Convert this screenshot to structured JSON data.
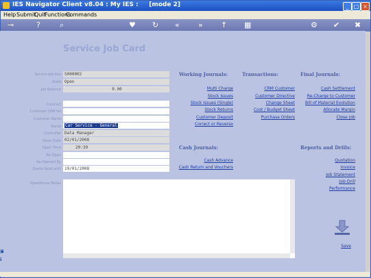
{
  "window": {
    "title": "IES Navigator Client v8.04 : My IES :     [mode 2]"
  },
  "menu": [
    "Help",
    "Submit",
    "Quit",
    "Functions",
    "Commands"
  ],
  "page_title": "Service Job Card",
  "fields": [
    {
      "label": "Service Job Key",
      "value": "S000002"
    },
    {
      "label": "State",
      "value": "Open"
    },
    {
      "label": "Job Balance",
      "value": "0.00"
    },
    {
      "label": "Contract",
      "value": ""
    },
    {
      "label": "Customer CRM No",
      "value": ""
    },
    {
      "label": "Customer Name",
      "value": ""
    },
    {
      "label": "Name",
      "value": "Car Service - General"
    },
    {
      "label": "Controller",
      "value": "Data Manager"
    },
    {
      "label": "Open Date",
      "value": "02/01/2008"
    },
    {
      "label": "Open Time",
      "value": "20:39"
    },
    {
      "label": "Re-Open",
      "value": ""
    },
    {
      "label": "Re-Opened By",
      "value": ""
    },
    {
      "label": "Quote Valid until",
      "value": "19/01/2008"
    },
    {
      "label": "Operational Notes",
      "value": ""
    }
  ],
  "sections": {
    "working": {
      "title": "Working Journals:",
      "links": [
        "Multi Charge",
        "Stock Issues",
        "Stock Issues (Single)",
        "Stock Returns",
        "Customer Deposit",
        "Correct or Reverse"
      ]
    },
    "transactions": {
      "title": "Transactions:",
      "links": [
        "CRM Customer",
        "Customer Directive",
        "Change Sheet",
        "Cost / Budget Sheet",
        "Purchase Orders"
      ]
    },
    "final": {
      "title": "Final Journals:",
      "links": [
        "Cash Settlement",
        "Re-Charge to Customer",
        "Bill of Material Evolution",
        "Allocate Margin",
        "Close Job"
      ]
    },
    "cash": {
      "title": "Cash Journals:",
      "links": [
        "Cash Advance",
        "Cash Return and Vouchers"
      ]
    },
    "reports": {
      "title": "Reports and Drills:",
      "links": [
        "Quotation",
        "Invoice",
        "Job Statement",
        "Job Drill",
        "Performance"
      ]
    }
  },
  "save_label": "Save"
}
